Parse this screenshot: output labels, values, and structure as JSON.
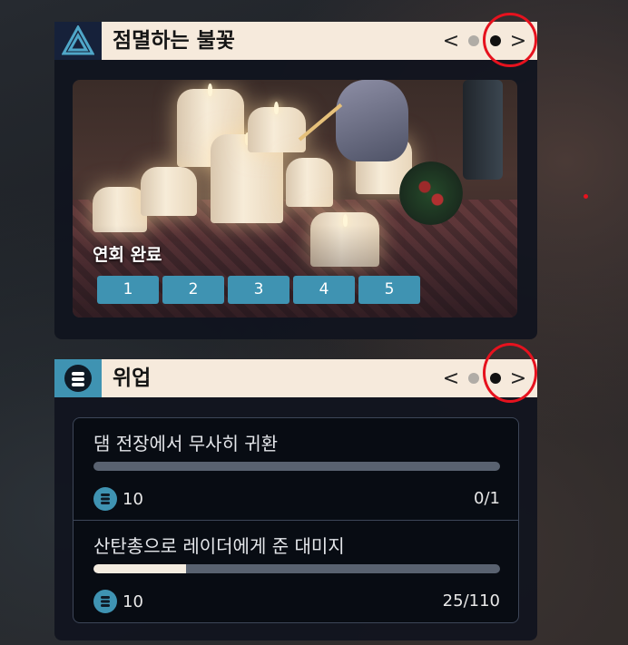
{
  "panels": {
    "blaze": {
      "title": "점멸하는 불꽃",
      "badge_icon": "triangle-emblem-icon",
      "prev_label": "<",
      "next_label": ">",
      "pages": 2,
      "current_page": 2,
      "event_label": "연회 완료",
      "steps": [
        "1",
        "2",
        "3",
        "4",
        "5"
      ]
    },
    "feat": {
      "title": "위업",
      "badge_icon": "coin-emblem-icon",
      "prev_label": "<",
      "next_label": ">",
      "pages": 2,
      "current_page": 2,
      "tasks": [
        {
          "name": "댐 전장에서 무사히 귀환",
          "reward": "10",
          "count": "0/1",
          "progress": 0
        },
        {
          "name": "산탄총으로 레이더에게 준 대미지",
          "reward": "10",
          "count": "25/110",
          "progress": 0.227
        }
      ]
    }
  },
  "colors": {
    "accent": "#3f93b2",
    "header_bg": "#f6eadc",
    "panel_bg": "#10141e",
    "annotation": "#e6121e"
  }
}
